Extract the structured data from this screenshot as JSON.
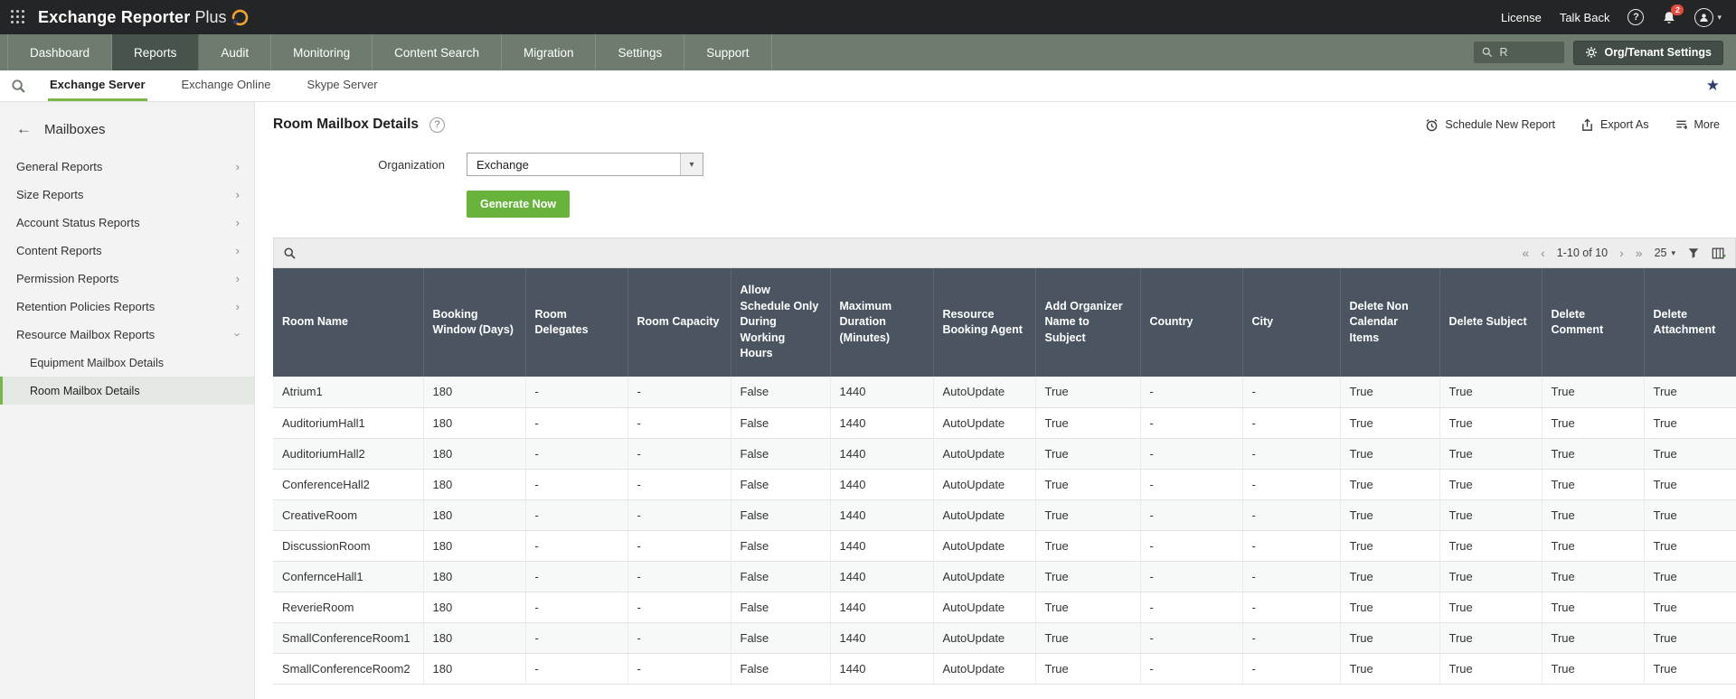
{
  "topbar": {
    "app_name": "Exchange Reporter",
    "app_name_suffix": "Plus",
    "license_label": "License",
    "talkback_label": "Talk Back",
    "help_label": "?",
    "notification_count": "2"
  },
  "navbar": {
    "tabs": [
      {
        "label": "Dashboard"
      },
      {
        "label": "Reports"
      },
      {
        "label": "Audit"
      },
      {
        "label": "Monitoring"
      },
      {
        "label": "Content Search"
      },
      {
        "label": "Migration"
      },
      {
        "label": "Settings"
      },
      {
        "label": "Support"
      }
    ],
    "active_tab": "Reports",
    "search_value": "R",
    "settings_button": "Org/Tenant Settings"
  },
  "subnav": {
    "tabs": [
      "Exchange Server",
      "Exchange Online",
      "Skype Server"
    ],
    "active_tab": "Exchange Server",
    "favorite_icon": "star"
  },
  "sidebar": {
    "title": "Mailboxes",
    "items": [
      {
        "label": "General Reports",
        "expanded": false
      },
      {
        "label": "Size Reports",
        "expanded": false
      },
      {
        "label": "Account Status Reports",
        "expanded": false
      },
      {
        "label": "Content Reports",
        "expanded": false
      },
      {
        "label": "Permission Reports",
        "expanded": false
      },
      {
        "label": "Retention Policies Reports",
        "expanded": false
      },
      {
        "label": "Resource Mailbox Reports",
        "expanded": true,
        "children": [
          "Equipment Mailbox Details",
          "Room Mailbox Details"
        ]
      }
    ],
    "active_item": "Room Mailbox Details"
  },
  "content": {
    "title": "Room Mailbox Details",
    "help_glyph": "?",
    "actions": [
      {
        "label": "Schedule New Report"
      },
      {
        "label": "Export As"
      },
      {
        "label": "More"
      }
    ],
    "form": {
      "organization_label": "Organization",
      "organization_value": "Exchange",
      "generate_label": "Generate Now"
    }
  },
  "table": {
    "pagination": {
      "first": "«",
      "prev": "‹",
      "range": "1-10 of 10",
      "next": "›",
      "last": "»",
      "page_size": "25"
    },
    "columns": [
      "Room Name",
      "Booking Window (Days)",
      "Room Delegates",
      "Room Capacity",
      "Allow Schedule Only During Working Hours",
      "Maximum Duration (Minutes)",
      "Resource Booking Agent",
      "Add Organizer Name to Subject",
      "Country",
      "City",
      "Delete Non Calendar Items",
      "Delete Subject",
      "Delete Comment",
      "Delete Attachment"
    ],
    "rows": [
      [
        "Atrium1",
        "180",
        "-",
        "-",
        "False",
        "1440",
        "AutoUpdate",
        "True",
        "-",
        "-",
        "True",
        "True",
        "True",
        "True"
      ],
      [
        "AuditoriumHall1",
        "180",
        "-",
        "-",
        "False",
        "1440",
        "AutoUpdate",
        "True",
        "-",
        "-",
        "True",
        "True",
        "True",
        "True"
      ],
      [
        "AuditoriumHall2",
        "180",
        "-",
        "-",
        "False",
        "1440",
        "AutoUpdate",
        "True",
        "-",
        "-",
        "True",
        "True",
        "True",
        "True"
      ],
      [
        "ConferenceHall2",
        "180",
        "-",
        "-",
        "False",
        "1440",
        "AutoUpdate",
        "True",
        "-",
        "-",
        "True",
        "True",
        "True",
        "True"
      ],
      [
        "CreativeRoom",
        "180",
        "-",
        "-",
        "False",
        "1440",
        "AutoUpdate",
        "True",
        "-",
        "-",
        "True",
        "True",
        "True",
        "True"
      ],
      [
        "DiscussionRoom",
        "180",
        "-",
        "-",
        "False",
        "1440",
        "AutoUpdate",
        "True",
        "-",
        "-",
        "True",
        "True",
        "True",
        "True"
      ],
      [
        "ConfernceHall1",
        "180",
        "-",
        "-",
        "False",
        "1440",
        "AutoUpdate",
        "True",
        "-",
        "-",
        "True",
        "True",
        "True",
        "True"
      ],
      [
        "ReverieRoom",
        "180",
        "-",
        "-",
        "False",
        "1440",
        "AutoUpdate",
        "True",
        "-",
        "-",
        "True",
        "True",
        "True",
        "True"
      ],
      [
        "SmallConferenceRoom1",
        "180",
        "-",
        "-",
        "False",
        "1440",
        "AutoUpdate",
        "True",
        "-",
        "-",
        "True",
        "True",
        "True",
        "True"
      ],
      [
        "SmallConferenceRoom2",
        "180",
        "-",
        "-",
        "False",
        "1440",
        "AutoUpdate",
        "True",
        "-",
        "-",
        "True",
        "True",
        "True",
        "True"
      ]
    ]
  }
}
